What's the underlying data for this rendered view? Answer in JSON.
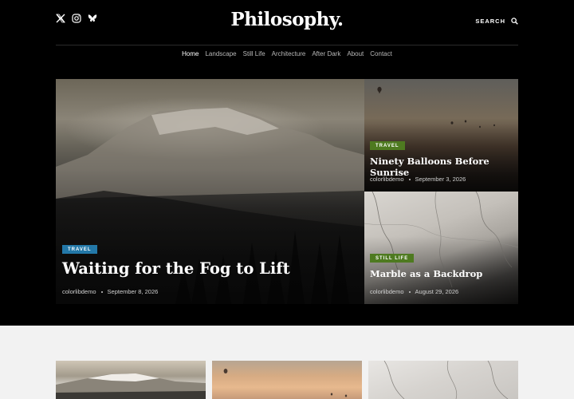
{
  "site": {
    "logo": "Philosophy.",
    "search_label": "SEARCH"
  },
  "social": [
    {
      "icon": "x-twitter-icon"
    },
    {
      "icon": "instagram-icon"
    },
    {
      "icon": "bluesky-butterfly-icon"
    }
  ],
  "nav": [
    {
      "label": "Home",
      "active": true
    },
    {
      "label": "Landscape",
      "active": false
    },
    {
      "label": "Still Life",
      "active": false
    },
    {
      "label": "Architecture",
      "active": false
    },
    {
      "label": "After Dark",
      "active": false
    },
    {
      "label": "About",
      "active": false
    },
    {
      "label": "Contact",
      "active": false
    }
  ],
  "featured": {
    "main": {
      "category": "TRAVEL",
      "category_color": "#2378a8",
      "title": "Waiting for the Fog to Lift",
      "author": "colorlibdemo",
      "date": "September 8, 2026"
    },
    "top_right": {
      "category": "TRAVEL",
      "category_color": "#4e7a20",
      "title": "Ninety Balloons Before Sunrise",
      "author": "colorlibdemo",
      "date": "September 3, 2026"
    },
    "bottom_right": {
      "category": "STILL LIFE",
      "category_color": "#4e7a20",
      "title": "Marble as a Backdrop",
      "author": "colorlibdemo",
      "date": "August 29, 2026"
    }
  },
  "colors": {
    "hero_bg": "#000000",
    "page_bg": "#f2f2f2"
  }
}
